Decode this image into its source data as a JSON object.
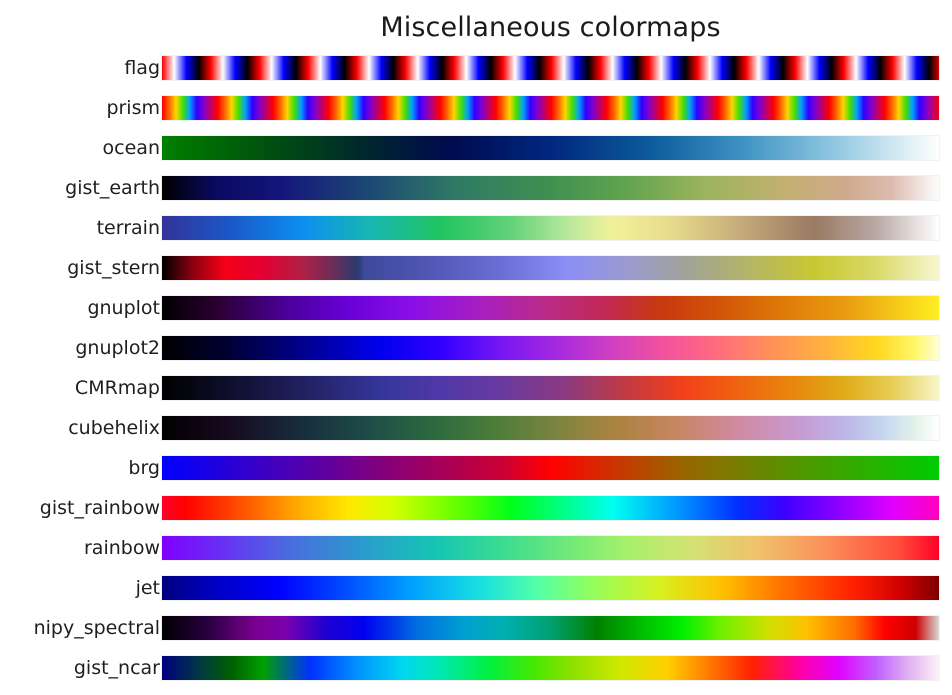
{
  "figure": {
    "title": "Miscellaneous colormaps",
    "background_color": "#ffffff",
    "text_color": "#1a1a1a"
  },
  "chart_data": {
    "type": "heatmap",
    "title": "Miscellaneous colormaps",
    "xlabel": "",
    "ylabel": "",
    "x": [
      0,
      1
    ],
    "xlim": [
      0,
      1
    ],
    "grid": false,
    "legend": "none",
    "description": "Matplotlib colormap reference: each row is a horizontal gradient bar showing one colormap evaluated from 0 to 1 left-to-right, labeled on the left.",
    "categories": [
      "flag",
      "prism",
      "ocean",
      "gist_earth",
      "terrain",
      "gist_stern",
      "gnuplot",
      "gnuplot2",
      "CMRmap",
      "cubehelix",
      "brg",
      "gist_rainbow",
      "rainbow",
      "jet",
      "nipy_spectral",
      "gist_ncar"
    ],
    "series": [
      {
        "name": "flag",
        "cyclic": true,
        "cycles": 16,
        "stops": [
          "#ff0000",
          "#ffffff",
          "#0000ff",
          "#000000"
        ]
      },
      {
        "name": "prism",
        "cyclic": true,
        "cycles": 14,
        "stops": [
          "#ff0000",
          "#ff6000",
          "#ffd500",
          "#46e000",
          "#00a0ff",
          "#3000ff",
          "#8000d0"
        ]
      },
      {
        "name": "ocean",
        "cyclic": false,
        "stops": [
          "#007f00",
          "#00560c",
          "#002a2a",
          "#000a4e",
          "#00277f",
          "#0d5c9c",
          "#3f94c4",
          "#94c9e2",
          "#ffffff"
        ]
      },
      {
        "name": "gist_earth",
        "cyclic": false,
        "stops": [
          "#000000",
          "#14147c",
          "#1d4a74",
          "#3f9050",
          "#9cb45d",
          "#c2b071",
          "#ddbcb0",
          "#fdfdfd"
        ]
      },
      {
        "name": "terrain",
        "cyclic": false,
        "stops": [
          "#333399",
          "#0c8ef0",
          "#22c460",
          "#b6e89c",
          "#f2f29a",
          "#c2a878",
          "#9a7a63",
          "#ffffff"
        ]
      },
      {
        "name": "gist_stern",
        "cyclic": false,
        "stops": [
          "#000000",
          "#f50018",
          "#b02045",
          "#2a3a6e",
          "#4f56b4",
          "#8b8ef5",
          "#a0a29c",
          "#c8c832",
          "#f7f7d0"
        ]
      },
      {
        "name": "gnuplot",
        "cyclic": false,
        "stops": [
          "#000000",
          "#4a0099",
          "#8a0fe8",
          "#b92a8a",
          "#c8380f",
          "#de7a08",
          "#ffee22"
        ]
      },
      {
        "name": "gnuplot2",
        "cyclic": false,
        "stops": [
          "#000000",
          "#00008c",
          "#0000ee",
          "#7a18f2",
          "#d040c0",
          "#ff6a80",
          "#ffb040",
          "#ffffd8"
        ]
      },
      {
        "name": "CMRmap",
        "cyclic": false,
        "stops": [
          "#000000",
          "#202060",
          "#35359a",
          "#8c3a80",
          "#f2401a",
          "#e8860d",
          "#e6cd55",
          "#f7f7c8"
        ]
      },
      {
        "name": "cubehelix",
        "cyclic": false,
        "stops": [
          "#000000",
          "#172a3a",
          "#2c6a3e",
          "#7d8440",
          "#c78560",
          "#d089a0",
          "#bdb6e8",
          "#ffffff"
        ]
      },
      {
        "name": "brg",
        "cyclic": false,
        "stops": [
          "#0000ff",
          "#990066",
          "#ff0000",
          "#996600",
          "#00cc00"
        ]
      },
      {
        "name": "gist_rainbow",
        "cyclic": false,
        "stops": [
          "#ff0029",
          "#ffa500",
          "#ffe800",
          "#64ff00",
          "#00ff8c",
          "#009cff",
          "#3c00ff",
          "#e000ff",
          "#ff00bf"
        ]
      },
      {
        "name": "rainbow",
        "cyclic": false,
        "stops": [
          "#8000ff",
          "#4b6ae0",
          "#14c4b4",
          "#75ea76",
          "#d4e272",
          "#fc8c58",
          "#ff0028"
        ]
      },
      {
        "name": "jet",
        "cyclic": false,
        "stops": [
          "#00007f",
          "#0000ff",
          "#00a0ff",
          "#50ffaa",
          "#d8f020",
          "#ff7000",
          "#7f0000"
        ]
      },
      {
        "name": "nipy_spectral",
        "cyclic": false,
        "stops": [
          "#000000",
          "#7a0090",
          "#0000f0",
          "#00b0b0",
          "#008000",
          "#00f000",
          "#ffc000",
          "#ff0000",
          "#d8d8d8"
        ]
      },
      {
        "name": "gist_ncar",
        "cyclic": false,
        "stops": [
          "#000080",
          "#006000",
          "#0030ff",
          "#00d8f0",
          "#00f040",
          "#90e000",
          "#ffd000",
          "#ff2000",
          "#e000ff",
          "#fdf2f8"
        ]
      }
    ]
  }
}
